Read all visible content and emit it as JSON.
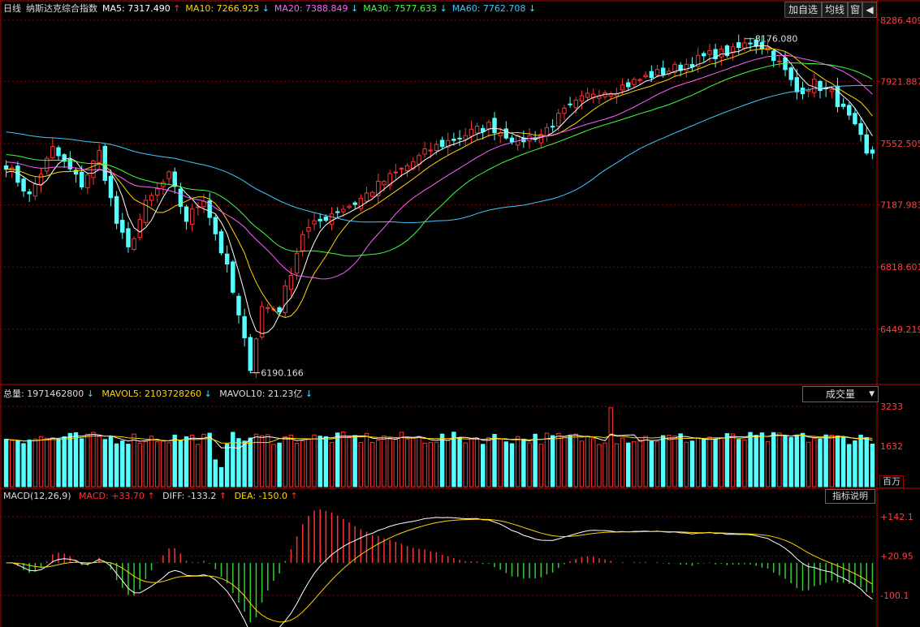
{
  "header": {
    "period": "日线",
    "name": "纳斯达克综合指数",
    "ma": [
      {
        "label": "MA5: 7317.490",
        "arrow": "↑",
        "color": "#ffffff",
        "arrow_color": "#ff3030"
      },
      {
        "label": "MA10: 7266.923",
        "arrow": "↓",
        "color": "#ffd400",
        "arrow_color": "#40e0ff"
      },
      {
        "label": "MA20: 7388.849",
        "arrow": "↓",
        "color": "#ff60ff",
        "arrow_color": "#40e0ff"
      },
      {
        "label": "MA30: 7577.633",
        "arrow": "↓",
        "color": "#40ff40",
        "arrow_color": "#40e0ff"
      },
      {
        "label": "MA60: 7762.708",
        "arrow": "↓",
        "color": "#40c8ff",
        "arrow_color": "#40e0ff"
      }
    ],
    "buttons": [
      "加自选",
      "均线",
      "窗",
      "◀"
    ]
  },
  "volume_header": {
    "total": "总量: 1971462800",
    "total_arrow": "↓",
    "mavol5": "MAVOL5: 2103728260",
    "mavol5_arrow": "↓",
    "mavol10": "MAVOL10: 21.23亿",
    "mavol10_arrow": "↓",
    "dropdown": "成交量",
    "dropdown_caret": "▼",
    "unit": "百万"
  },
  "macd_header": {
    "name": "MACD(12,26,9)",
    "macd": "MACD: +33.70",
    "macd_arrow": "↑",
    "diff": "DIFF: -133.2",
    "diff_arrow": "↑",
    "dea": "DEA: -150.0",
    "dea_arrow": "↑",
    "help": "指标说明"
  },
  "chart_data": [
    {
      "type": "candlestick",
      "title": "纳斯达克综合指数",
      "ylim": [
        6130,
        8300
      ],
      "y_ticks": [
        8286.409,
        7921.887,
        7552.505,
        7187.983,
        6818.601,
        6449.219
      ],
      "annotations": [
        {
          "label": "8176.080",
          "bar": 127,
          "value": 8176.08
        },
        {
          "label": "6190.166",
          "bar": 42,
          "value": 6190.166
        }
      ],
      "close_anchors": [
        [
          0,
          7430
        ],
        [
          4,
          7240
        ],
        [
          8,
          7520
        ],
        [
          13,
          7310
        ],
        [
          16,
          7500
        ],
        [
          19,
          7080
        ],
        [
          21,
          6920
        ],
        [
          24,
          7190
        ],
        [
          28,
          7360
        ],
        [
          31,
          7100
        ],
        [
          34,
          7230
        ],
        [
          38,
          6810
        ],
        [
          42,
          6230
        ],
        [
          44,
          6580
        ],
        [
          47,
          6570
        ],
        [
          51,
          7020
        ],
        [
          56,
          7140
        ],
        [
          60,
          7200
        ],
        [
          65,
          7330
        ],
        [
          69,
          7420
        ],
        [
          73,
          7520
        ],
        [
          77,
          7580
        ],
        [
          83,
          7660
        ],
        [
          88,
          7570
        ],
        [
          92,
          7610
        ],
        [
          96,
          7740
        ],
        [
          101,
          7860
        ],
        [
          105,
          7880
        ],
        [
          111,
          7960
        ],
        [
          116,
          8010
        ],
        [
          121,
          8080
        ],
        [
          125,
          8100
        ],
        [
          128,
          8160
        ],
        [
          131,
          8120
        ],
        [
          134,
          7980
        ],
        [
          136,
          7860
        ],
        [
          139,
          7910
        ],
        [
          142,
          7850
        ],
        [
          145,
          7700
        ],
        [
          147,
          7580
        ],
        [
          148,
          7480
        ],
        [
          149,
          7500
        ]
      ],
      "volume": {
        "ylim": [
          0,
          3400
        ],
        "y_ticks": [
          3233,
          1632
        ]
      },
      "macd": {
        "ylim": [
          -190,
          180
        ],
        "y_ticks": [
          142.1,
          20.95,
          -100.1
        ]
      }
    }
  ],
  "colors": {
    "up": "#ff3232",
    "down": "#54ffff",
    "grid": "#8b0000",
    "axis": "#c00000",
    "ma5": "#ffffff",
    "ma10": "#ffd400",
    "ma20": "#ff60ff",
    "ma30": "#40ff40",
    "ma60": "#40c8ff",
    "macd_up": "#ff3232",
    "macd_down": "#33cc33"
  }
}
